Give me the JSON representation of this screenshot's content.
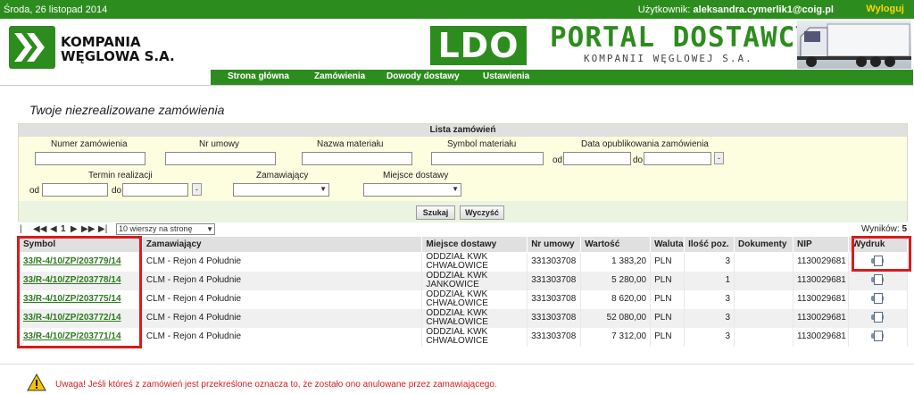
{
  "topbar": {
    "date": "Środa, 26 listopad 2014",
    "user_label": "Użytkownik:",
    "user_email": "aleksandra.cymerlik1@coig.pl",
    "logout": "Wyloguj"
  },
  "header": {
    "company_line1": "KOMPANIA",
    "company_line2": "WĘGLOWA S.A.",
    "ldo": "LDO",
    "portal_title": "PORTAL DOSTAWCY",
    "portal_sub": "KOMPANII WĘGLOWEJ S.A."
  },
  "nav": {
    "items": [
      {
        "label": "Strona główna"
      },
      {
        "label": "Zamówienia"
      },
      {
        "label": "Dowody dostawy"
      },
      {
        "label": "Ustawienia"
      }
    ]
  },
  "page": {
    "title": "Twoje niezrealizowane zamówienia"
  },
  "filter": {
    "header": "Lista zamówień",
    "order_number": "Numer zamówienia",
    "contract_number": "Nr umowy",
    "material_name": "Nazwa materiału",
    "material_symbol": "Symbol materiału",
    "publish_date": "Data opublikowania zamówienia",
    "from": "od",
    "to": "do",
    "deadline": "Termin realizacji",
    "orderer": "Zamawiający",
    "delivery_place": "Miejsce dostawy",
    "search_btn": "Szukaj",
    "clear_btn": "Wyczyść"
  },
  "pager": {
    "page": "1",
    "per_page": "10 wierszy na stronę",
    "results_label": "Wyników:",
    "results_count": "5"
  },
  "table": {
    "headers": {
      "symbol": "Symbol",
      "orderer": "Zamawiający",
      "place": "Miejsce dostawy",
      "contract": "Nr umowy",
      "value": "Wartość",
      "currency": "Waluta",
      "qty": "Ilość poz.",
      "docs": "Dokumenty",
      "nip": "NIP",
      "print": "Wydruk"
    },
    "rows": [
      {
        "symbol": "33/R-4/10/ZP/203779/14",
        "orderer": "CLM - Rejon 4 Południe",
        "place": "ODDZIAŁ KWK CHWAŁOWICE",
        "contract": "331303708",
        "value": "1 383,20",
        "currency": "PLN",
        "qty": "3",
        "nip": "1130029681"
      },
      {
        "symbol": "33/R-4/10/ZP/203778/14",
        "orderer": "CLM - Rejon 4 Południe",
        "place": "ODDZIAŁ KWK JANKOWICE",
        "contract": "331303708",
        "value": "5 280,00",
        "currency": "PLN",
        "qty": "1",
        "nip": "1130029681"
      },
      {
        "symbol": "33/R-4/10/ZP/203775/14",
        "orderer": "CLM - Rejon 4 Południe",
        "place": "ODDZIAŁ KWK CHWAŁOWICE",
        "contract": "331303708",
        "value": "8 620,00",
        "currency": "PLN",
        "qty": "3",
        "nip": "1130029681"
      },
      {
        "symbol": "33/R-4/10/ZP/203772/14",
        "orderer": "CLM - Rejon 4 Południe",
        "place": "ODDZIAŁ KWK CHWAŁOWICE",
        "contract": "331303708",
        "value": "52 080,00",
        "currency": "PLN",
        "qty": "3",
        "nip": "1130029681"
      },
      {
        "symbol": "33/R-4/10/ZP/203771/14",
        "orderer": "CLM - Rejon 4 Południe",
        "place": "ODDZIAŁ KWK CHWAŁOWICE",
        "contract": "331303708",
        "value": "7 312,00",
        "currency": "PLN",
        "qty": "3",
        "nip": "1130029681"
      }
    ]
  },
  "warning": {
    "text": "Uwaga! Jeśli któreś z zamówień jest przekreślone oznacza to, że zostało ono anulowane przez zamawiającego."
  },
  "colors": {
    "brand_green": "#2d8c1e",
    "highlight_red": "#d81c1c",
    "link_green": "#2d7a1e"
  }
}
